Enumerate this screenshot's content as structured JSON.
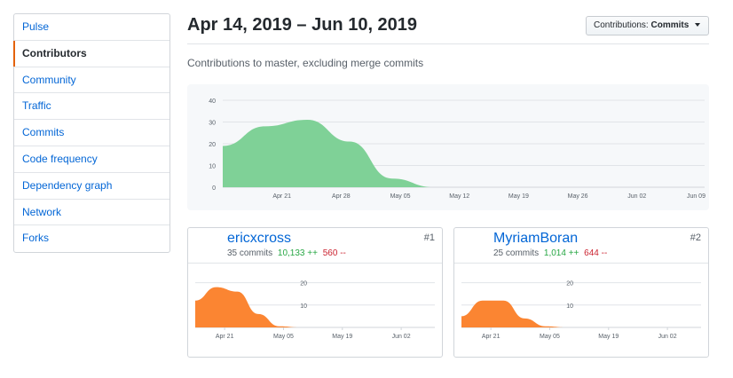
{
  "sidebar": {
    "items": [
      {
        "label": "Pulse",
        "selected": false
      },
      {
        "label": "Contributors",
        "selected": true
      },
      {
        "label": "Community",
        "selected": false
      },
      {
        "label": "Traffic",
        "selected": false
      },
      {
        "label": "Commits",
        "selected": false
      },
      {
        "label": "Code frequency",
        "selected": false
      },
      {
        "label": "Dependency graph",
        "selected": false
      },
      {
        "label": "Network",
        "selected": false
      },
      {
        "label": "Forks",
        "selected": false
      }
    ]
  },
  "header": {
    "date_range": "Apr 14, 2019 – Jun 10, 2019",
    "dropdown_prefix": "Contributions:",
    "dropdown_value": "Commits",
    "subtitle": "Contributions to master, excluding merge commits"
  },
  "colors": {
    "main_area": "#7fd197",
    "contributor_area": "#fb8532",
    "link": "#0366d6",
    "additions": "#28a745",
    "deletions": "#cb2431",
    "selected_accent": "#e36209"
  },
  "chart_data": [
    {
      "type": "area",
      "x_ticks": [
        "Apr 21",
        "Apr 28",
        "May 05",
        "May 12",
        "May 19",
        "May 26",
        "Jun 02",
        "Jun 09"
      ],
      "y_ticks": [
        0,
        10,
        20,
        30,
        40
      ],
      "ylim": [
        0,
        40
      ],
      "xlim": [
        "2019-04-14",
        "2019-06-10"
      ],
      "x": [
        "2019-04-14",
        "2019-04-19",
        "2019-04-24",
        "2019-04-29",
        "2019-05-04",
        "2019-05-09"
      ],
      "values": [
        19,
        28,
        31,
        21,
        4,
        0
      ],
      "color": "#7fd197"
    },
    {
      "type": "area",
      "x_ticks": [
        "Apr 21",
        "May 05",
        "May 19",
        "Jun 02"
      ],
      "y_ticks": [
        10,
        20
      ],
      "ylim": [
        0,
        25
      ],
      "xlim": [
        "2019-04-14",
        "2019-06-10"
      ],
      "x": [
        "2019-04-14",
        "2019-04-19",
        "2019-04-24",
        "2019-04-29",
        "2019-05-04",
        "2019-05-09"
      ],
      "values": [
        12,
        18,
        16,
        6,
        0.5,
        0
      ],
      "color": "#fb8532"
    },
    {
      "type": "area",
      "x_ticks": [
        "Apr 21",
        "May 05",
        "May 19",
        "Jun 02"
      ],
      "y_ticks": [
        10,
        20
      ],
      "ylim": [
        0,
        25
      ],
      "xlim": [
        "2019-04-14",
        "2019-06-10"
      ],
      "x": [
        "2019-04-14",
        "2019-04-19",
        "2019-04-24",
        "2019-04-29",
        "2019-05-04",
        "2019-05-09"
      ],
      "values": [
        5,
        12,
        12,
        4,
        0.5,
        0
      ],
      "color": "#fb8532"
    }
  ],
  "contributors": [
    {
      "username": "ericxcross",
      "commits": "35 commits",
      "additions": "10,133 ++",
      "deletions": "560 --",
      "rank": "#1",
      "avatar_icon": "person-avatar-icon"
    },
    {
      "username": "MyriamBoran",
      "commits": "25 commits",
      "additions": "1,014 ++",
      "deletions": "644 --",
      "rank": "#2",
      "avatar_icon": "cartoon-avatar-icon"
    }
  ]
}
